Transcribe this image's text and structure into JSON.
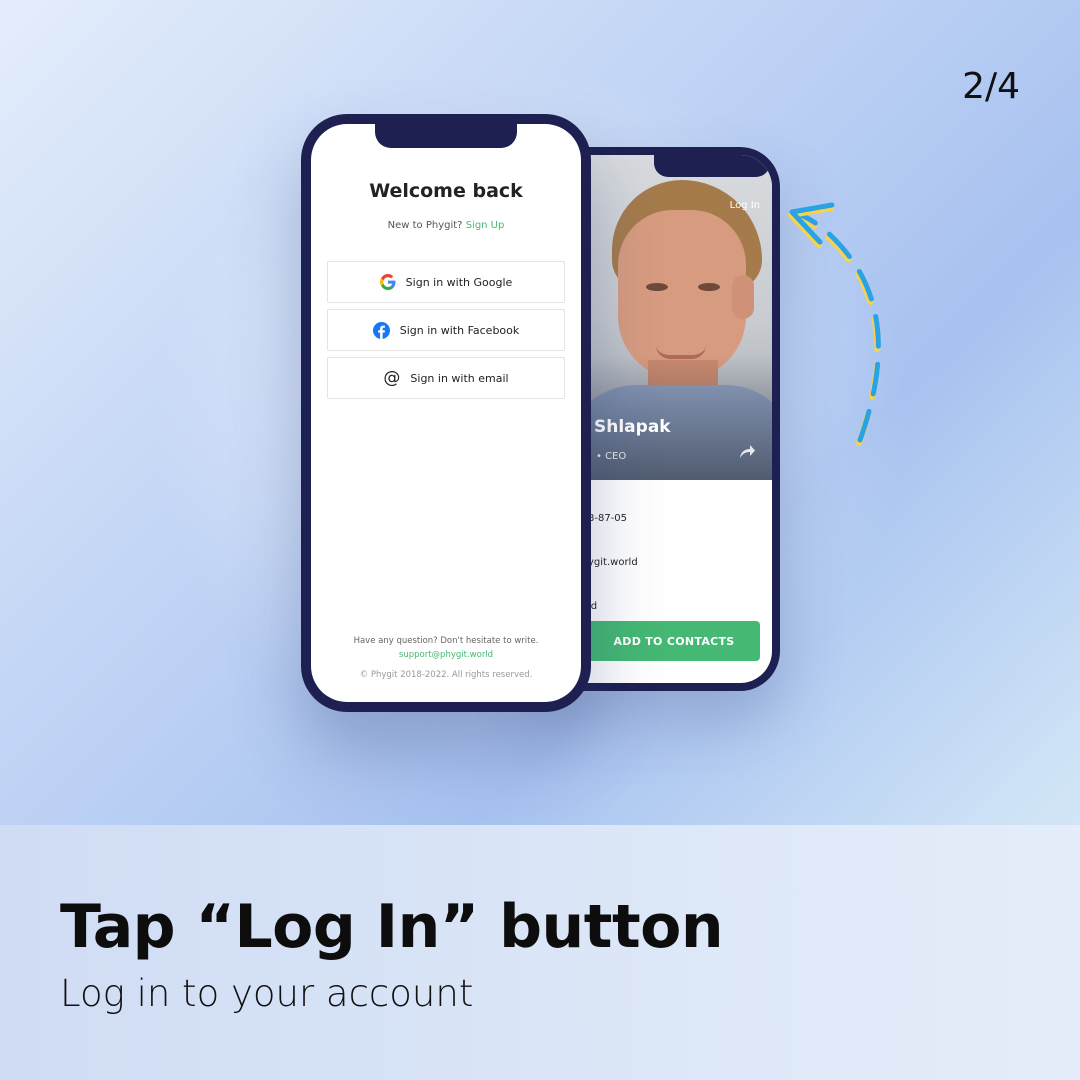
{
  "page_counter": "2/4",
  "headline": "Tap “Log In” button",
  "subline": "Log in to your account",
  "back_phone": {
    "login_link": "Log In",
    "name": "Shlapak",
    "role": "• CEO",
    "phone": "8-87-05",
    "email": "ygit.world",
    "website": "ld",
    "add_button": "ADD TO CONTACTS"
  },
  "front_phone": {
    "title": "Welcome back",
    "new_to": "New to Phygit?",
    "sign_up": "Sign Up",
    "buttons": [
      {
        "label": "Sign in with Google",
        "icon": "google-icon"
      },
      {
        "label": "Sign in with Facebook",
        "icon": "facebook-icon"
      },
      {
        "label": "Sign in with email",
        "icon": "at-icon"
      }
    ],
    "help_text": "Have any question? Don't hesitate to write.",
    "support_email": "support@phygit.world",
    "copyright": "© Phygit 2018-2022. All rights reserved."
  },
  "colors": {
    "accent_green": "#45b873",
    "phone_frame": "#1d2050",
    "arrow_blue": "#2aa3e6",
    "arrow_yellow": "#f7d24a"
  }
}
